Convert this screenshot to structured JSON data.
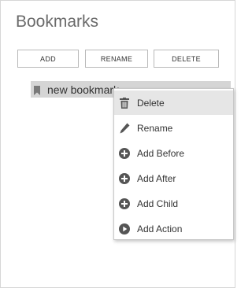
{
  "panel": {
    "title": "Bookmarks"
  },
  "toolbar": {
    "add_label": "ADD",
    "rename_label": "RENAME",
    "delete_label": "DELETE"
  },
  "tree": {
    "items": [
      {
        "label": "new bookmark",
        "icon": "bookmark-icon",
        "selected": true
      }
    ]
  },
  "context_menu": {
    "items": [
      {
        "label": "Delete",
        "icon": "trash-icon",
        "highlighted": true
      },
      {
        "label": "Rename",
        "icon": "pencil-icon"
      },
      {
        "label": "Add Before",
        "icon": "plus-circle-icon"
      },
      {
        "label": "Add After",
        "icon": "plus-circle-icon"
      },
      {
        "label": "Add Child",
        "icon": "plus-circle-icon"
      },
      {
        "label": "Add Action",
        "icon": "play-circle-icon"
      }
    ]
  }
}
